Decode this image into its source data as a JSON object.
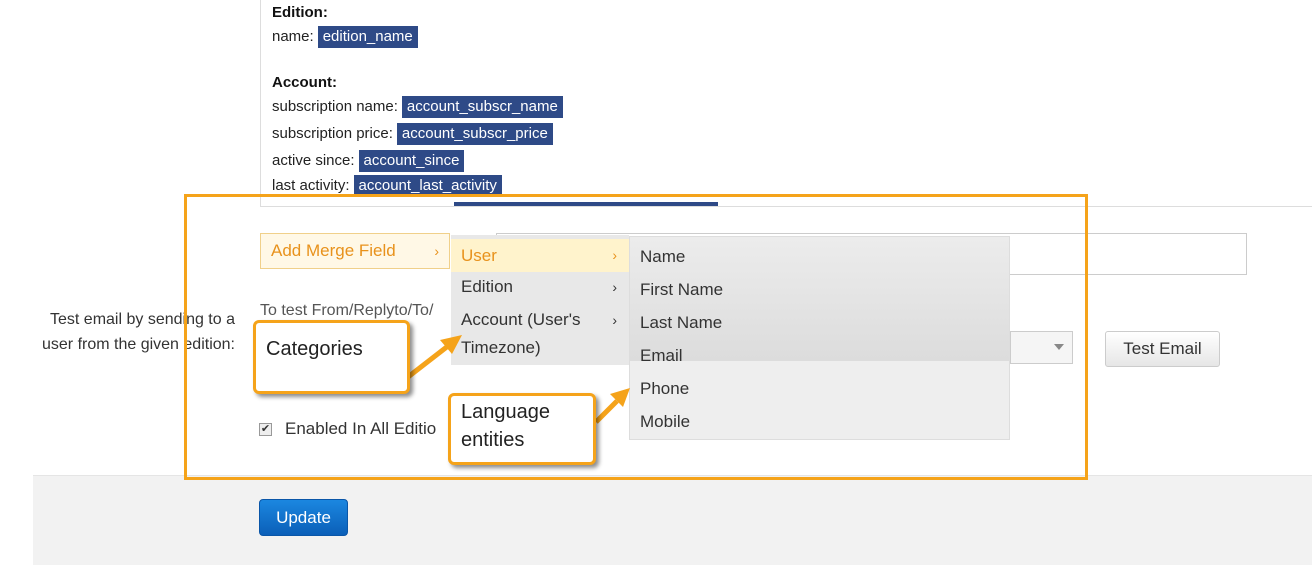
{
  "preview": {
    "edition_heading": "Edition:",
    "edition_rows": [
      {
        "label": "name:",
        "tag": "edition_name"
      }
    ],
    "account_heading": "Account:",
    "account_rows": [
      {
        "label": "subscription name:",
        "tag": "account_subscr_name"
      },
      {
        "label": "subscription price:",
        "tag": "account_subscr_price"
      },
      {
        "label": "active since:",
        "tag": "account_since"
      },
      {
        "label": "last activity:",
        "tag": "account_last_activity"
      }
    ]
  },
  "merge": {
    "button_label": "Add Merge Field",
    "categories": [
      "User",
      "Edition",
      "Account (User's Timezone)"
    ],
    "active_category": "User",
    "fields": [
      "Name",
      "First Name",
      "Last Name",
      "Email",
      "Phone",
      "Mobile"
    ]
  },
  "test": {
    "label": "Test email by sending to a user from the given edition:",
    "hint": "To test From/Replyto/To/",
    "button_label": "Test Email"
  },
  "enabled": {
    "label": "Enabled In All Editio",
    "checked": true
  },
  "footer": {
    "update_label": "Update"
  },
  "annotations": {
    "categories_label": "Categories",
    "lang_label": "Language entities",
    "color": "#f5a31a"
  },
  "colors": {
    "tag_bg": "#2e4a87",
    "merge_accent": "#e8921c",
    "update_bg": "#0b6ecf"
  }
}
